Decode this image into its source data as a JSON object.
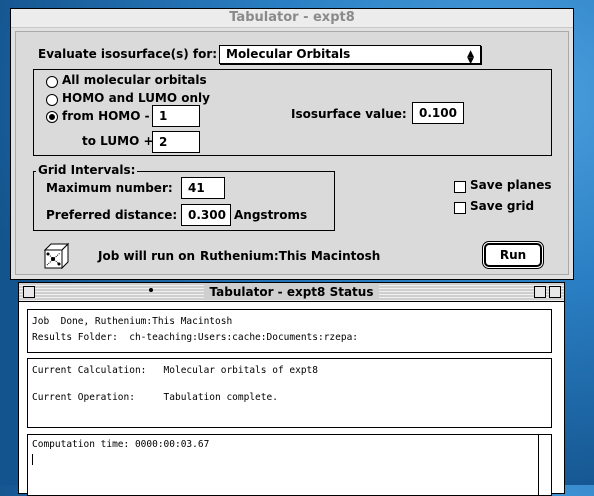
{
  "tabulator": {
    "title": "Tabulator - expt8",
    "evaluate_label": "Evaluate isosurface(s) for:",
    "evaluate_value": "Molecular Orbitals",
    "options": [
      {
        "label": "All molecular orbitals",
        "selected": false
      },
      {
        "label": "HOMO and LUMO only",
        "selected": false
      },
      {
        "label": "from HOMO -",
        "selected": true
      }
    ],
    "homo_value": "1",
    "to_lumo_label": "to LUMO +",
    "lumo_value": "2",
    "isosurface_label": "Isosurface value:",
    "isosurface_value": "0.100",
    "grid_label": "Grid Intervals:",
    "max_number_label": "Maximum number:",
    "max_number_value": "41",
    "pref_distance_label": "Preferred distance:",
    "pref_distance_value": "0.300",
    "angstroms_label": "Angstroms",
    "save_planes_label": "Save planes",
    "save_grid_label": "Save grid",
    "job_label": "Job will run on",
    "job_host": "Ruthenium:This Macintosh",
    "run_label": "Run"
  },
  "status": {
    "title": "Tabulator - expt8 Status",
    "line1": "Job  Done, Ruthenium:This Macintosh",
    "line2": "Results Folder:  ch-teaching:Users:cache:Documents:rzepa:",
    "calc_line": "Current Calculation:   Molecular orbitals of expt8",
    "op_line": "Current Operation:     Tabulation complete.",
    "time_line": "Computation time: 0000:00:03.67"
  }
}
